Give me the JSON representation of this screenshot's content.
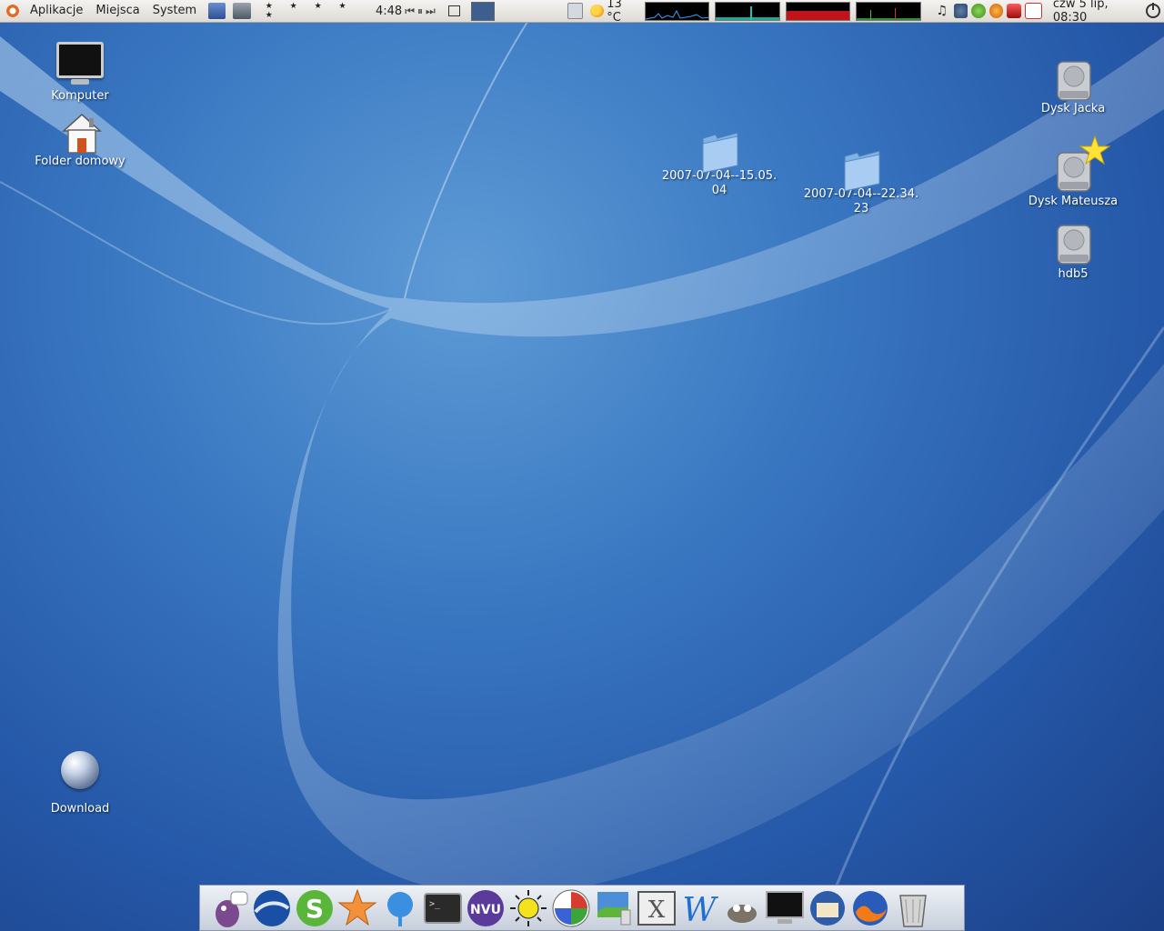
{
  "top_panel": {
    "menus": [
      "Aplikacje",
      "Miejsca",
      "System"
    ],
    "rating_stars": "★ ★ ★ ★ ★",
    "player_time": "4:48",
    "player_prev": "⏮",
    "player_pause": "⏸",
    "player_next": "⏭",
    "weather_temp": "13 °C",
    "clock": "czw  5 lip, 08:30"
  },
  "desktop": {
    "icons": {
      "computer": "Komputer",
      "home": "Folder domowy",
      "folder1_line1": "2007-07-04--15.05.",
      "folder1_line2": "04",
      "folder2_line1": "2007-07-04--22.34.",
      "folder2_line2": "23",
      "drive1": "Dysk Jacka",
      "drive2": "Dysk Mateusza",
      "drive3": "hdb5",
      "download": "Download"
    }
  },
  "dock": {
    "items": [
      "pidgin-icon",
      "google-earth-icon",
      "skype-icon",
      "star-icon",
      "network-icon",
      "terminal-icon",
      "nvu-icon",
      "sun-smiley-icon",
      "picasa-icon",
      "screenshot-icon",
      "xchat-icon",
      "writer-icon",
      "gimp-icon",
      "monitor-icon",
      "thunderbird-icon",
      "firefox-icon",
      "trash-icon"
    ]
  },
  "colors": {
    "wallpaper": "#3a78c2",
    "panel": "#e8e6e2",
    "dock": "#dde2ea"
  }
}
